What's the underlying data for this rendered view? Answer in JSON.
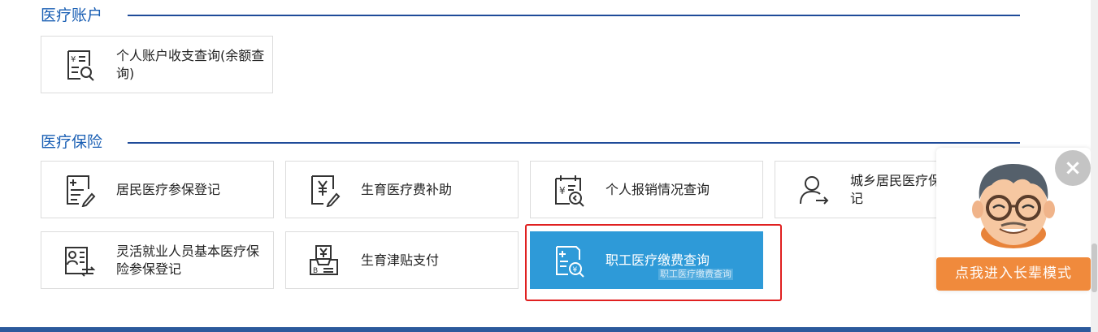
{
  "sections": {
    "account": {
      "title": "医疗账户"
    },
    "insurance": {
      "title": "医疗保险"
    }
  },
  "cards": {
    "account_query": {
      "label": "个人账户收支查询(余额查询)",
      "icon": "account-query-icon"
    },
    "resident_enroll": {
      "label": "居民医疗参保登记",
      "icon": "medical-form-icon"
    },
    "maternity_subsidy": {
      "label": "生育医疗费补助",
      "icon": "yuan-pen-icon"
    },
    "reimburse_query": {
      "label": "个人报销情况查询",
      "icon": "calendar-yuan-search-icon"
    },
    "urban_rural_suspend": {
      "label": "城乡居民医疗保险中断登记",
      "icon": "person-arrow-icon"
    },
    "flexible_enroll": {
      "label": "灵活就业人员基本医疗保险参保登记",
      "icon": "id-card-exchange-icon"
    },
    "maternity_allowance": {
      "label": "生育津贴支付",
      "icon": "yuan-tray-icon"
    },
    "employee_payment": {
      "label": "职工医疗缴费查询",
      "icon": "medical-yuan-search-icon"
    }
  },
  "drag_ghost": "职工医疗缴费查询",
  "elder_mode": {
    "button": "点我进入长辈模式",
    "close": "×"
  },
  "colors": {
    "accent": "#1a5fb4",
    "line": "#1f4b99",
    "active_card": "#2e9ad8",
    "highlight": "#e02020",
    "elder_button": "#f08a3c"
  }
}
